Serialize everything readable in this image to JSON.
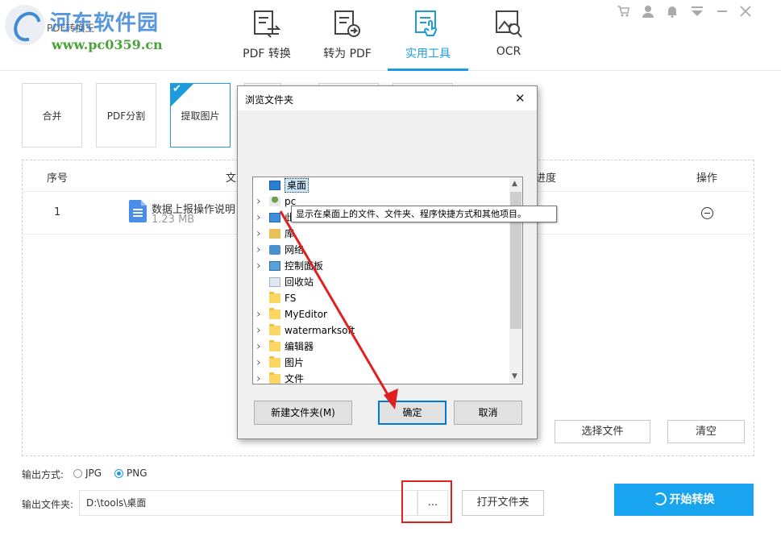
{
  "app": {
    "title": "PDF转换王"
  },
  "watermark": {
    "name": "河东软件园",
    "url": "www.pc0359.cn"
  },
  "nav": {
    "tabs": [
      {
        "label": "PDF 转换",
        "icon": "pdf-convert-icon"
      },
      {
        "label": "转为 PDF",
        "icon": "to-pdf-icon"
      },
      {
        "label": "实用工具",
        "icon": "tools-icon",
        "active": true
      },
      {
        "label": "OCR",
        "icon": "ocr-icon"
      }
    ]
  },
  "topright_icons": [
    "cart-icon",
    "user-icon",
    "bell-icon",
    "menu-icon",
    "minimize-icon",
    "close-icon"
  ],
  "tools": {
    "cards": [
      "合并",
      "PDF分割",
      "提取图片"
    ],
    "selected": "提取图片"
  },
  "table": {
    "headers": {
      "index": "序号",
      "file": "文",
      "progress": "进度",
      "action": "操作"
    },
    "rows": [
      {
        "index": "1",
        "name": "数据上报操作说明",
        "size": "1.23 MB"
      }
    ]
  },
  "panel_buttons": {
    "select_file": "选择文件",
    "clear": "清空"
  },
  "output": {
    "format_label": "输出方式:",
    "format_options": [
      "JPG",
      "PNG"
    ],
    "format_selected": "PNG",
    "folder_label": "输出文件夹:",
    "folder_path": "D:\\tools\\桌面",
    "browse": "...",
    "open_folder": "打开文件夹",
    "start": "开始转换"
  },
  "dialog": {
    "title": "浏览文件夹",
    "close": "✕",
    "tree": [
      {
        "label": "桌面",
        "icon": "desktop-icon",
        "expand": false,
        "selected": true
      },
      {
        "label": "pc",
        "icon": "user-folder-icon",
        "expand": true
      },
      {
        "label": "此电脑",
        "icon": "computer-icon",
        "expand": true
      },
      {
        "label": "库",
        "icon": "library-icon",
        "expand": true
      },
      {
        "label": "网络",
        "icon": "network-icon",
        "expand": true
      },
      {
        "label": "控制面板",
        "icon": "control-panel-icon",
        "expand": true
      },
      {
        "label": "回收站",
        "icon": "recycle-bin-icon",
        "expand": false
      },
      {
        "label": "FS",
        "icon": "folder-icon",
        "expand": false
      },
      {
        "label": "MyEditor",
        "icon": "folder-icon",
        "expand": true
      },
      {
        "label": "watermarksoft",
        "icon": "folder-icon",
        "expand": true
      },
      {
        "label": "编辑器",
        "icon": "folder-icon",
        "expand": true
      },
      {
        "label": "图片",
        "icon": "folder-icon",
        "expand": true
      },
      {
        "label": "文件",
        "icon": "folder-icon",
        "expand": true
      }
    ],
    "tooltip": "显示在桌面上的文件、文件夹、程序快捷方式和其他项目。",
    "new_folder": "新建文件夹(M)",
    "ok": "确定",
    "cancel": "取消"
  },
  "colors": {
    "accent": "#1c9cde",
    "start_button": "#19a4f0",
    "annotation": "#e02020"
  }
}
